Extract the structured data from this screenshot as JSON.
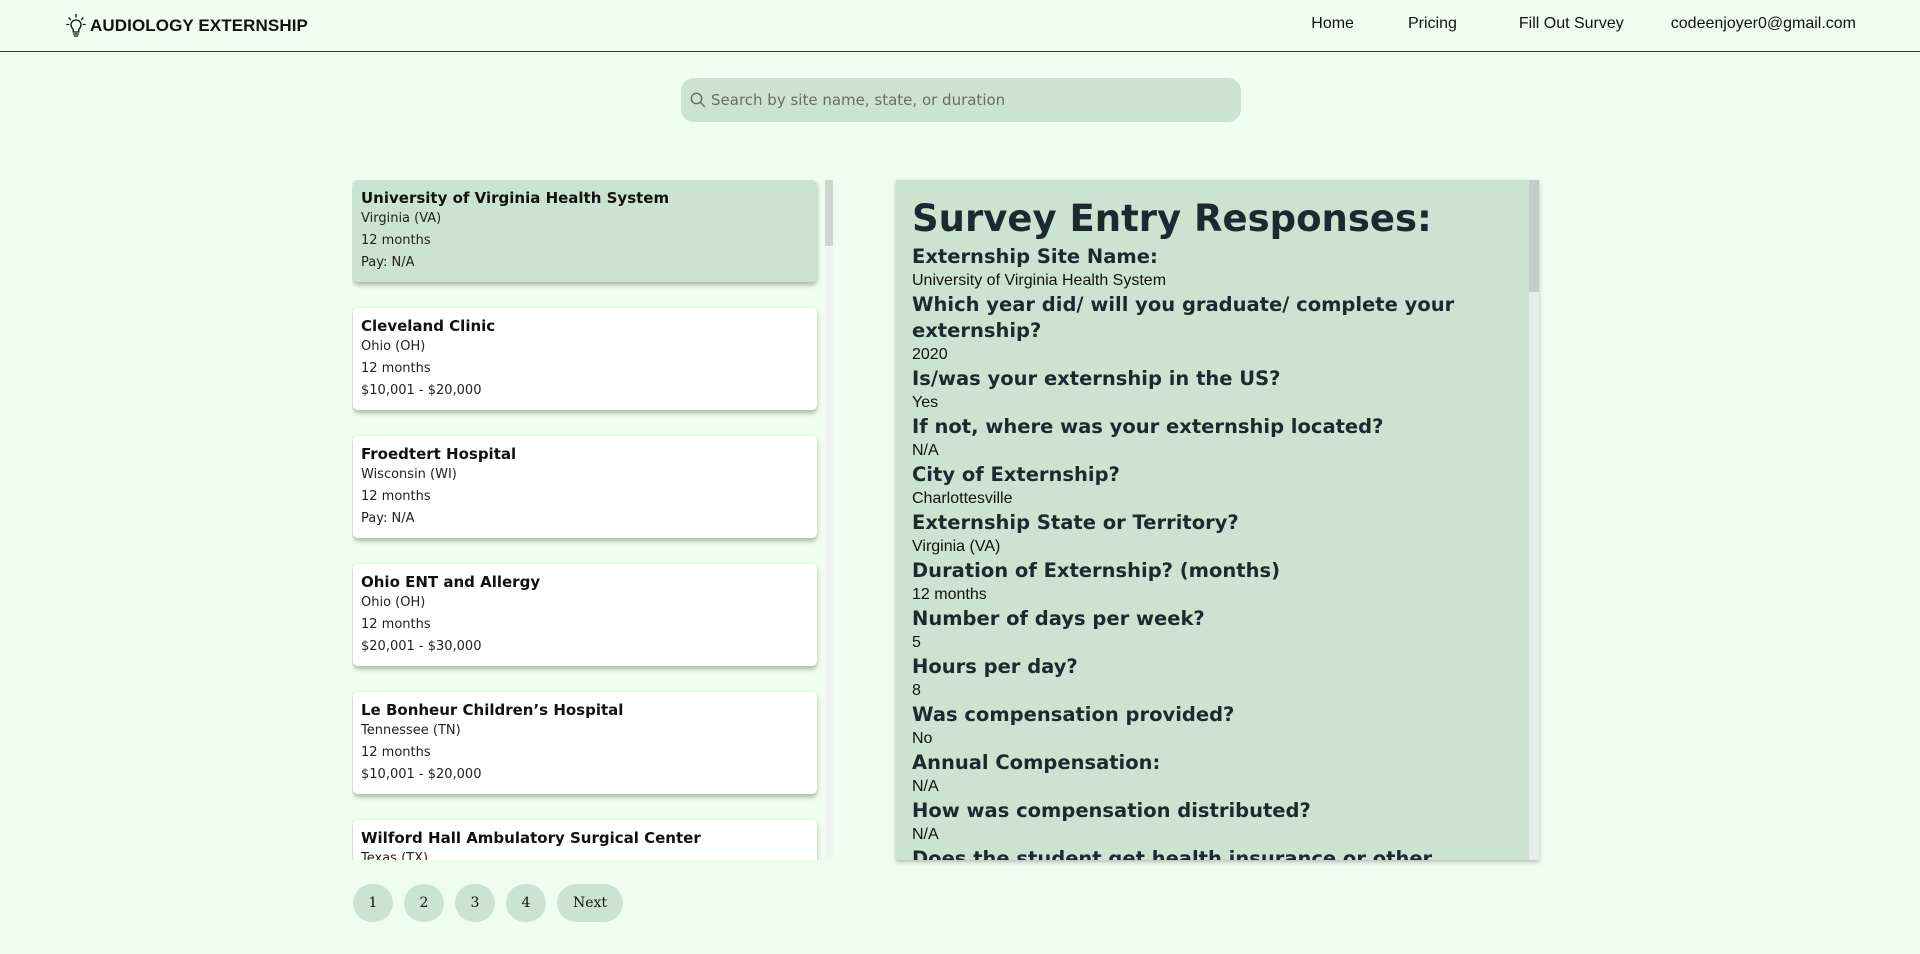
{
  "brand": {
    "name": "AUDIOLOGY EXTERNSHIP",
    "icon": "lightbulb-icon"
  },
  "nav": {
    "home": "Home",
    "pricing": "Pricing",
    "survey": "Fill Out Survey",
    "user_email": "codeenjoyer0@gmail.com"
  },
  "search": {
    "placeholder": "Search by site name, state, or duration",
    "value": "",
    "icon": "search-icon"
  },
  "sites": [
    {
      "name": "University of Virginia Health System",
      "state": "Virginia (VA)",
      "duration": "12 months",
      "pay": "Pay: N/A",
      "selected": true
    },
    {
      "name": "Cleveland Clinic",
      "state": "Ohio (OH)",
      "duration": "12 months",
      "pay": "$10,001 - $20,000",
      "selected": false
    },
    {
      "name": "Froedtert Hospital",
      "state": "Wisconsin (WI)",
      "duration": "12 months",
      "pay": "Pay: N/A",
      "selected": false
    },
    {
      "name": "Ohio ENT and Allergy",
      "state": "Ohio (OH)",
      "duration": "12 months",
      "pay": "$20,001 - $30,000",
      "selected": false
    },
    {
      "name": "Le Bonheur Children’s Hospital",
      "state": "Tennessee (TN)",
      "duration": "12 months",
      "pay": "$10,001 - $20,000",
      "selected": false
    },
    {
      "name": "Wilford Hall Ambulatory Surgical Center",
      "state": "Texas (TX)",
      "duration": "",
      "pay": "",
      "selected": false
    }
  ],
  "pagination": [
    "1",
    "2",
    "3",
    "4",
    "Next"
  ],
  "detail": {
    "heading": "Survey Entry Responses:",
    "items": [
      {
        "q": "Externship Site Name:",
        "a": "University of Virginia Health System"
      },
      {
        "q": "Which year did/ will you graduate/ complete your externship?",
        "a": "2020"
      },
      {
        "q": "Is/was your externship in the US?",
        "a": "Yes"
      },
      {
        "q": "If not, where was your externship located?",
        "a": "N/A"
      },
      {
        "q": "City of Externship?",
        "a": "Charlottesville"
      },
      {
        "q": "Externship State or Territory?",
        "a": "Virginia (VA)"
      },
      {
        "q": "Duration of Externship? (months)",
        "a": "12 months"
      },
      {
        "q": "Number of days per week?",
        "a": "5"
      },
      {
        "q": "Hours per day?",
        "a": "8"
      },
      {
        "q": "Was compensation provided?",
        "a": "No"
      },
      {
        "q": "Annual Compensation:",
        "a": "N/A"
      },
      {
        "q": "How was compensation distributed?",
        "a": "N/A"
      },
      {
        "q": "Does the student get health insurance or other benefits?",
        "a": ""
      }
    ]
  },
  "colors": {
    "background": "#effcf0",
    "accent_green": "#cce3d1",
    "card": "#ffffff",
    "heading_text": "#1c2a2f"
  }
}
